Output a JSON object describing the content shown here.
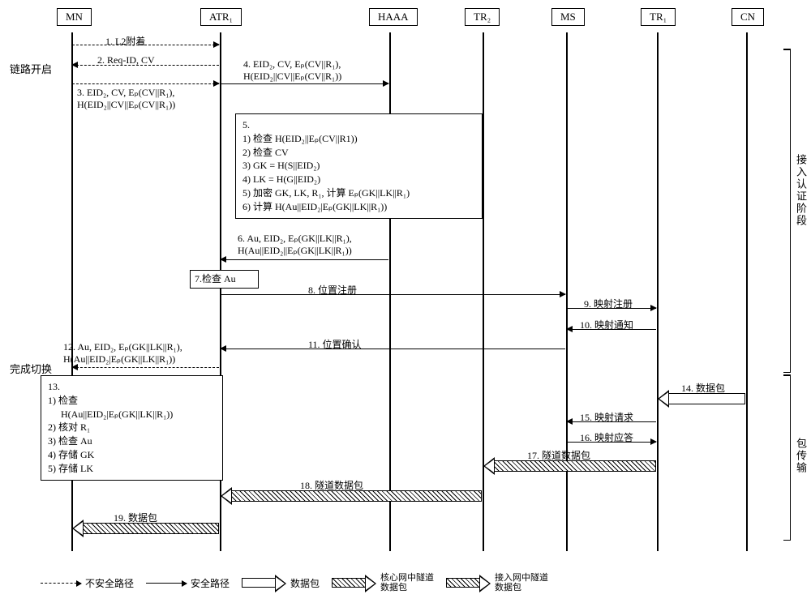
{
  "participants": {
    "mn": "MN",
    "atr1": "ATR₁",
    "haaa": "HAAA",
    "tr2": "TR₂",
    "ms": "MS",
    "tr1": "TR₁",
    "cn": "CN"
  },
  "side_labels": {
    "link_open": "链路开启",
    "handover_complete": "完成切换"
  },
  "phases": {
    "access_auth": "接入认证阶段",
    "packet_transfer": "包传输"
  },
  "messages": {
    "m1": "1. L2附着",
    "m2": "2. Req-ID, CV",
    "m3_l1": "3. EID₂, CV, Eₚ(CV||R₁),",
    "m3_l2": "H(EID₂||CV||Eₚ(CV||R₁))",
    "m4_l1": "4. EID₂, CV, Eₚ(CV||R₁),",
    "m4_l2": "H(EID₂||CV||Eₚ(CV||R₁))",
    "m6_l1": "6. Au, EID₂, Eₚ(GK||LK||R₁),",
    "m6_l2": "H(Au||EID₂||Eₚ(GK||LK||R₁))",
    "m8": "8. 位置注册",
    "m9": "9. 映射注册",
    "m10": "10. 映射通知",
    "m11": "11. 位置确认",
    "m12_l1": "12. Au, EID₂, Eₚ(GK||LK||R₁),",
    "m12_l2": "H(Au||EID₂|Eₚ(GK||LK||R₁))",
    "m14": "14. 数据包",
    "m15": "15. 映射请求",
    "m16": "16. 映射应答",
    "m17": "17. 隧道数据包",
    "m18": "18. 隧道数据包",
    "m19": "19. 数据包"
  },
  "boxes": {
    "b5_header": "5.",
    "b5_1": "1) 检查 H(EID₂||Eₚ(CV||R1))",
    "b5_2": "2) 检查 CV",
    "b5_3": "3) GK = H(S||EID₂)",
    "b5_4": "4) LK = H(G||EID₂)",
    "b5_5": "5) 加密 GK, LK, R₁, 计算 Eₚ(GK||LK||R₁)",
    "b5_6": "6) 计算 H(Au||EID₂|Eₚ(GK||LK||R₁))",
    "b7": "7.检查 Au",
    "b13_header": "13.",
    "b13_1": "1) 检查",
    "b13_1b": "   H(Au||EID₂|Eₚ(GK||LK||R₁))",
    "b13_2": "2) 核对 R₁",
    "b13_3": "3) 检查 Au",
    "b13_4": "4) 存储 GK",
    "b13_5": "5) 存储 LK"
  },
  "legend": {
    "insecure": "不安全路径",
    "secure": "安全路径",
    "packet": "数据包",
    "core_tunnel_l1": "核心网中隧道",
    "core_tunnel_l2": "数据包",
    "access_tunnel_l1": "接入网中隧道",
    "access_tunnel_l2": "数据包"
  }
}
